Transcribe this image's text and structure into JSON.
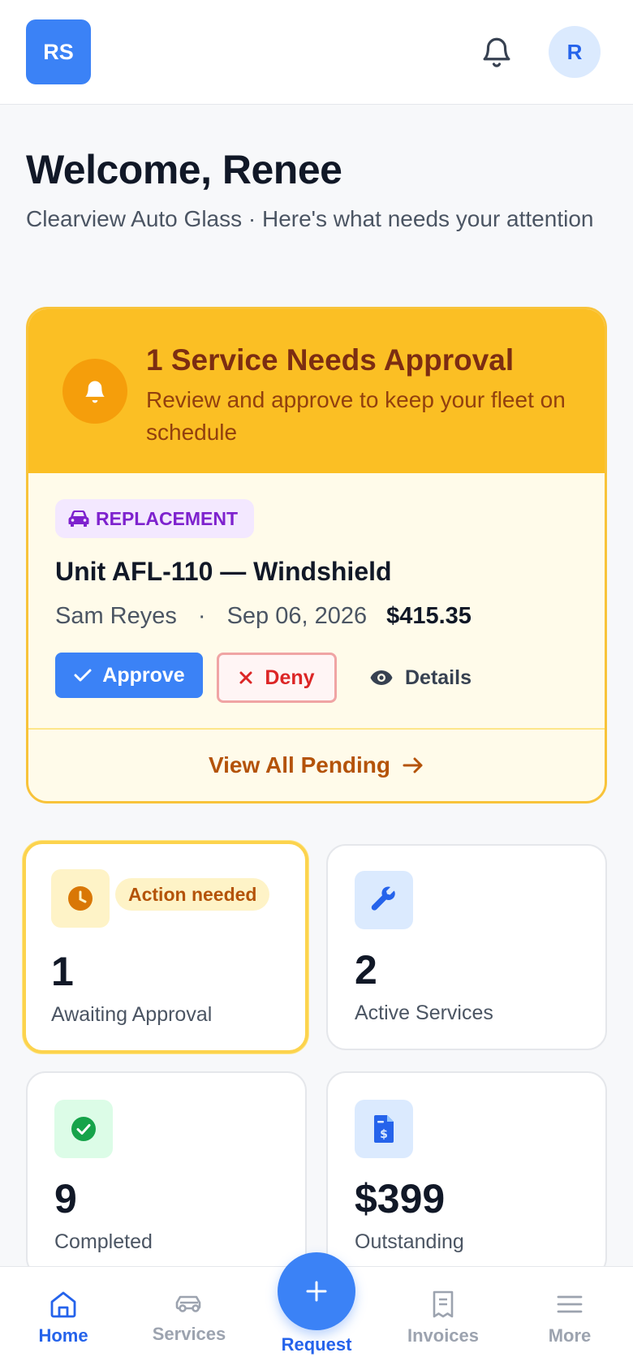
{
  "header": {
    "logo_text": "RS",
    "avatar_initial": "R",
    "bell_icon": "bell-icon"
  },
  "welcome": {
    "title": "Welcome, Renee",
    "subtitle": "Clearview Auto Glass · Here's what needs your attention"
  },
  "approval": {
    "title": "1 Service Needs Approval",
    "description": "Review and approve to keep your fleet on schedule",
    "item": {
      "badge": "REPLACEMENT",
      "unit": "Unit AFL-110 — Windshield",
      "technician": "Sam Reyes",
      "separator": "·",
      "date": "Sep 06, 2026",
      "price": "$415.35"
    },
    "approve_label": "Approve",
    "deny_label": "Deny",
    "details_label": "Details",
    "view_all_label": "View All Pending"
  },
  "stats": [
    {
      "value": "1",
      "label": "Awaiting Approval",
      "pill": "Action needed",
      "icon": "clock-icon"
    },
    {
      "value": "2",
      "label": "Active Services",
      "icon": "wrench-icon"
    },
    {
      "value": "9",
      "label": "Completed",
      "icon": "check-circle-icon"
    },
    {
      "value": "$399",
      "label": "Outstanding",
      "icon": "invoice-dollar-icon"
    }
  ],
  "nav": {
    "home": "Home",
    "services": "Services",
    "request": "Request",
    "invoices": "Invoices",
    "more": "More"
  },
  "colors": {
    "primary": "#3b82f6",
    "warning": "#fbbf24",
    "danger": "#dc2626",
    "success": "#16a34a"
  }
}
